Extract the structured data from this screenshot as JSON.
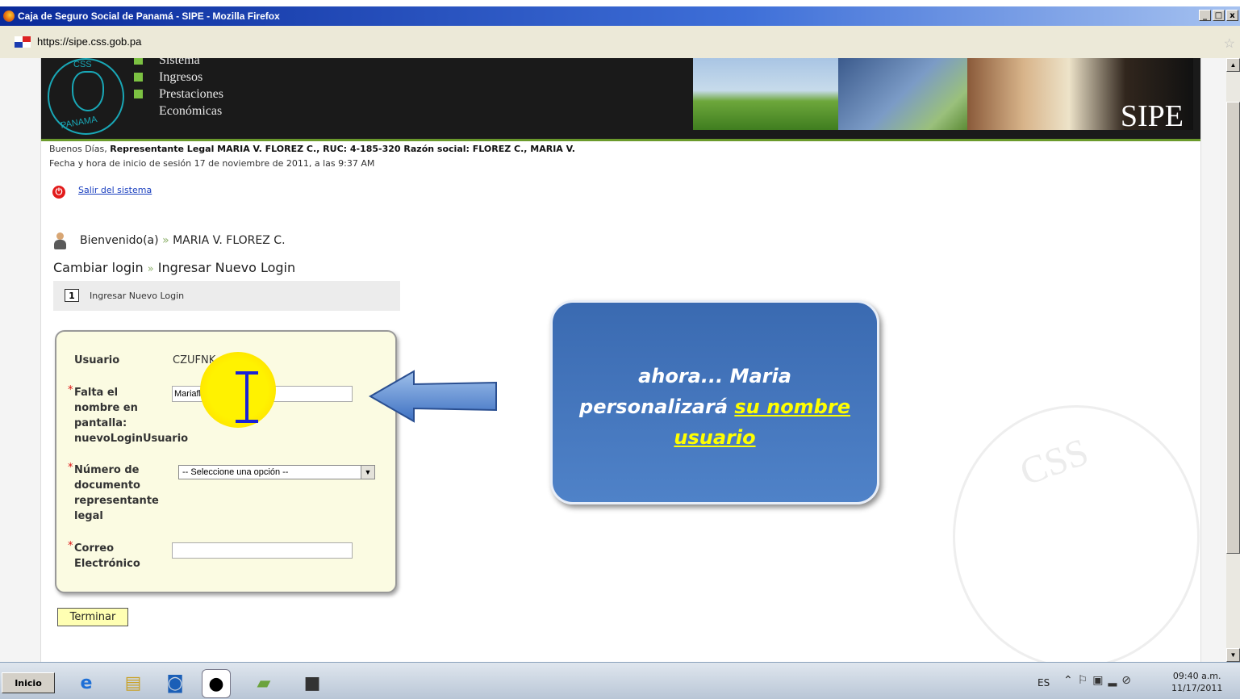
{
  "window": {
    "title": "Caja de Seguro Social de Panamá - SIPE - Mozilla Firefox",
    "buttons": [
      "_",
      "□",
      "x"
    ]
  },
  "browser": {
    "url": "https://sipe.css.gob.pa"
  },
  "header": {
    "logo_top": "CSS",
    "logo_bottom": "PANAMA",
    "menu": [
      "Sistema",
      "Ingresos",
      "Prestaciones",
      "Económicas"
    ],
    "brand": "SIPE"
  },
  "session": {
    "greeting_prefix": "Buenos Días, ",
    "greeting_bold": "Representante Legal MARIA V. FLOREZ C., RUC: 4-185-320 Razón social: FLOREZ C., MARIA V.",
    "start_time": "Fecha y hora de inicio de sesión 17 de noviembre de 2011, a las 9:37 AM",
    "logout": "Salir del sistema"
  },
  "welcome": {
    "label": "Bienvenido(a)",
    "sep": "»",
    "name": "MARIA V. FLOREZ C."
  },
  "breadcrumb": {
    "first": "Cambiar login",
    "sep": "»",
    "second": "Ingresar Nuevo Login"
  },
  "step": {
    "number": "1",
    "label": "Ingresar Nuevo Login"
  },
  "form": {
    "usuario_label": "Usuario",
    "usuario_value": "CZUFNK",
    "nombre_label_1": "Falta el",
    "nombre_label_2": "nombre en",
    "nombre_label_3": "pantalla:",
    "nombre_label_4": "nuevoLoginUsuario",
    "nombre_value": "Mariaflorez",
    "documento_label_1": "Número de",
    "documento_label_2": "documento",
    "documento_label_3": "representante",
    "documento_label_4": "legal",
    "documento_selected": "-- Seleccione una opción --",
    "correo_label_1": "Correo",
    "correo_label_2": "Electrónico",
    "correo_value": "",
    "required_mark": "*",
    "submit": "Terminar"
  },
  "callout": {
    "line1": "ahora...  Maria",
    "line2": "personalizará",
    "highlight_1": "su nombre",
    "highlight_2": "usuario"
  },
  "taskbar": {
    "start": "Inicio",
    "lang": "ES",
    "time": "09:40 a.m.",
    "date": "11/17/2011"
  },
  "colors": {
    "header_bg": "#1a1a1a",
    "accent_green": "#7cc142",
    "callout_blue": "#4a7cc2",
    "form_bg": "#fbfbe2"
  }
}
